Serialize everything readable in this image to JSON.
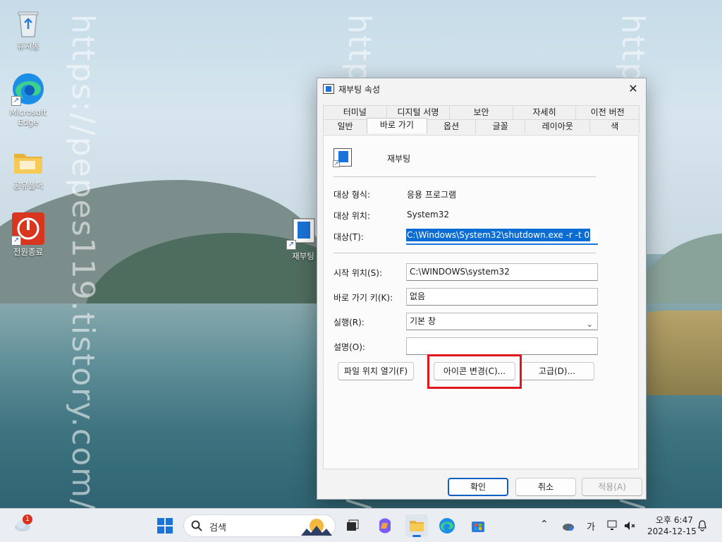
{
  "desktop": {
    "watermark": "https://pepes119.tistory.com/",
    "icons": [
      {
        "label": "휴지통"
      },
      {
        "label": "Microsoft Edge"
      },
      {
        "label": "공유폴더"
      },
      {
        "label": "전원종료"
      },
      {
        "label": "재부팅"
      }
    ]
  },
  "dialog": {
    "title": "재부팅 속성",
    "close_glyph": "✕",
    "tabs_row1": [
      "터미널",
      "디지털 서명",
      "보안",
      "자세히",
      "이전 버전"
    ],
    "tabs_row2": [
      "일반",
      "바로 가기",
      "옵션",
      "글꼴",
      "레이아웃",
      "색"
    ],
    "active_tab": "바로 가기",
    "app_name": "재부팅",
    "target_type_label": "대상 형식:",
    "target_type_value": "응용 프로그램",
    "target_location_label": "대상 위치:",
    "target_location_value": "System32",
    "target_label": "대상(T):",
    "target_value": "C:\\Windows\\System32\\shutdown.exe -r -t 0",
    "start_in_label": "시작 위치(S):",
    "start_in_value": "C:\\WINDOWS\\system32",
    "shortcut_key_label": "바로 가기 키(K):",
    "shortcut_key_value": "없음",
    "run_label": "실행(R):",
    "run_value": "기본 창",
    "comment_label": "설명(O):",
    "comment_value": "",
    "open_location_button": "파일 위치 열기(F)",
    "change_icon_button": "아이콘 변경(C)...",
    "advanced_button": "고급(D)...",
    "ok_button": "확인",
    "cancel_button": "취소",
    "apply_button": "적용(A)"
  },
  "taskbar": {
    "search_placeholder": "검색",
    "weather_badge": "1",
    "ime_label": "가",
    "time": "오후 6:47",
    "date": "2024-12-15"
  },
  "colors": {
    "accent": "#0b6cd3",
    "highlight_box": "#e0161d"
  }
}
